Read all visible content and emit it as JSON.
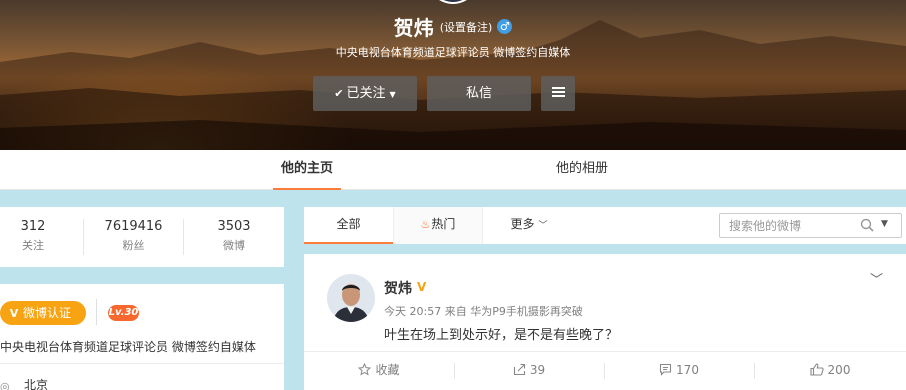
{
  "profile": {
    "name": "贺炜",
    "remark_link": "(设置备注)",
    "gender_icon": "male-symbol",
    "intro": "中央电视台体育频道足球评论员 微博签约自媒体"
  },
  "actions": {
    "follow_label": "已关注",
    "message_label": "私信"
  },
  "profile_tabs": [
    "他的主页",
    "他的相册"
  ],
  "stats": [
    {
      "value": "312",
      "label": "关注"
    },
    {
      "value": "7619416",
      "label": "粉丝"
    },
    {
      "value": "3503",
      "label": "微博"
    }
  ],
  "info": {
    "verify_label": "微博认证",
    "level": "Lv.30",
    "description": "中央电视台体育频道足球评论员 微博签约自媒体",
    "location": "北京"
  },
  "feed_filter": {
    "tabs": [
      "全部",
      "热门",
      "更多"
    ],
    "search_placeholder": "搜索他的微博"
  },
  "post": {
    "author": "贺炜",
    "vip_badge": "V",
    "meta": "今天 20:57 来自 华为P9手机摄影再突破",
    "text": "叶生在场上到处示好，是不是有些晚了？",
    "favorite_label": "收藏",
    "forwards": "39",
    "comments": "170",
    "likes": "200"
  },
  "colors": {
    "accent_orange": "#fa7d3c",
    "verify_gold": "#f7a312",
    "level_red": "#f7682f",
    "page_bg": "#bfe3ec"
  }
}
